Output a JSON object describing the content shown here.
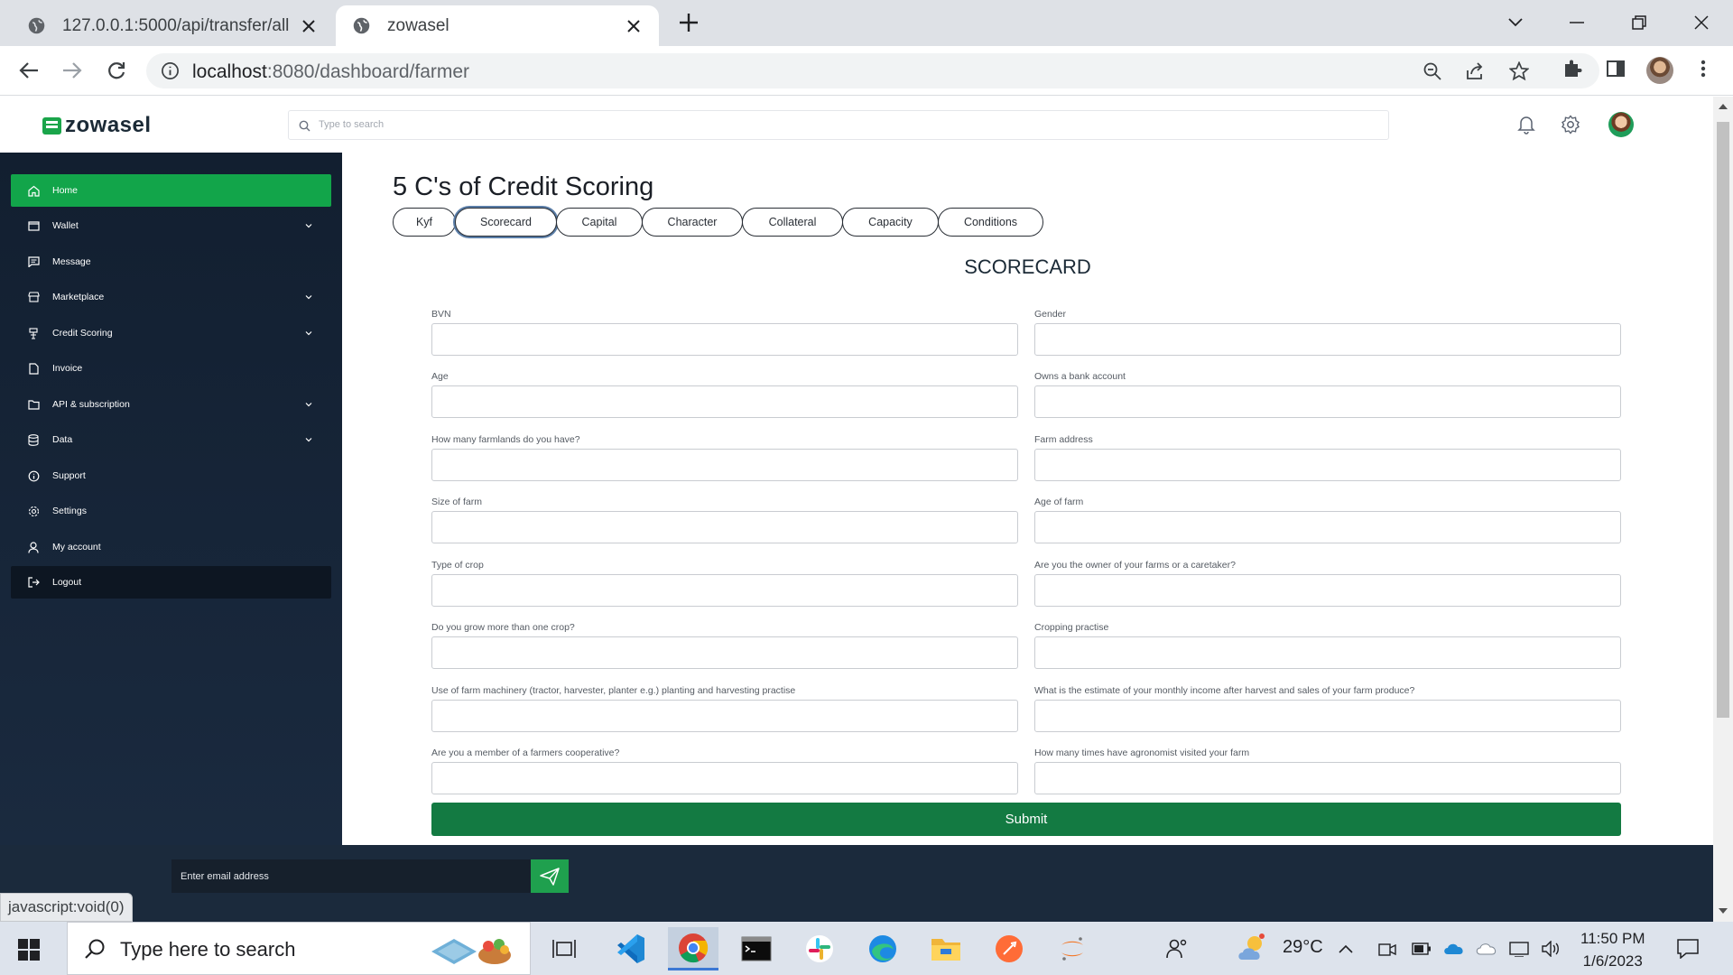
{
  "browser": {
    "tabs": [
      {
        "title": "127.0.0.1:5000/api/transfer/all"
      },
      {
        "title": "zowasel"
      }
    ],
    "url_host": "localhost",
    "url_path": ":8080/dashboard/farmer",
    "status_text": "javascript:void(0)"
  },
  "app": {
    "logo": "zowasel",
    "search_placeholder": "Type to search"
  },
  "sidebar": {
    "items": [
      {
        "label": "Home",
        "icon": "home-icon",
        "active": true
      },
      {
        "label": "Wallet",
        "icon": "wallet-icon",
        "has_submenu": true
      },
      {
        "label": "Message",
        "icon": "message-icon"
      },
      {
        "label": "Marketplace",
        "icon": "store-icon",
        "has_submenu": true
      },
      {
        "label": "Credit Scoring",
        "icon": "credit-icon",
        "has_submenu": true
      },
      {
        "label": "Invoice",
        "icon": "invoice-icon"
      },
      {
        "label": "API & subscription",
        "icon": "folder-icon",
        "has_submenu": true
      },
      {
        "label": "Data",
        "icon": "database-icon",
        "has_submenu": true
      },
      {
        "label": "Support",
        "icon": "support-icon"
      },
      {
        "label": "Settings",
        "icon": "settings-icon"
      },
      {
        "label": "My account",
        "icon": "user-icon"
      },
      {
        "label": "Logout",
        "icon": "logout-icon"
      }
    ]
  },
  "main": {
    "title": "5 C's of Credit Scoring",
    "tabs": [
      "Kyf",
      "Scorecard",
      "Capital",
      "Character",
      "Collateral",
      "Capacity",
      "Conditions"
    ],
    "active_tab": "Scorecard",
    "section_title": "SCORECARD",
    "fields_left": [
      {
        "label": "BVN",
        "value": ""
      },
      {
        "label": "Age",
        "value": ""
      },
      {
        "label": "How many farmlands do you have?",
        "value": ""
      },
      {
        "label": "Size of farm",
        "value": ""
      },
      {
        "label": "Type of crop",
        "value": ""
      },
      {
        "label": "Do you grow more than one crop?",
        "value": ""
      },
      {
        "label": "Use of farm machinery (tractor, harvester, planter e.g.) planting and harvesting practise",
        "value": ""
      },
      {
        "label": "Are you a member of a farmers cooperative?",
        "value": ""
      }
    ],
    "fields_right": [
      {
        "label": "Gender",
        "value": ""
      },
      {
        "label": "Owns a bank account",
        "value": ""
      },
      {
        "label": "Farm address",
        "value": ""
      },
      {
        "label": "Age of farm",
        "value": ""
      },
      {
        "label": "Are you the owner of your farms or a caretaker?",
        "value": ""
      },
      {
        "label": "Cropping practise",
        "value": ""
      },
      {
        "label": "What is the estimate of your monthly income after harvest and sales of your farm produce?",
        "value": ""
      },
      {
        "label": "How many times have agronomist visited your farm",
        "value": ""
      }
    ],
    "submit_label": "Submit"
  },
  "footer": {
    "email_placeholder": "Enter email address"
  },
  "taskbar": {
    "search_placeholder": "Type here to search",
    "weather": "29°C",
    "time": "11:50 PM",
    "date": "1/6/2023"
  },
  "colors": {
    "brand_green": "#12a54a",
    "submit_green": "#137a42",
    "sidebar_bg": "#121f30",
    "footer_bg": "#1b2a3c"
  }
}
